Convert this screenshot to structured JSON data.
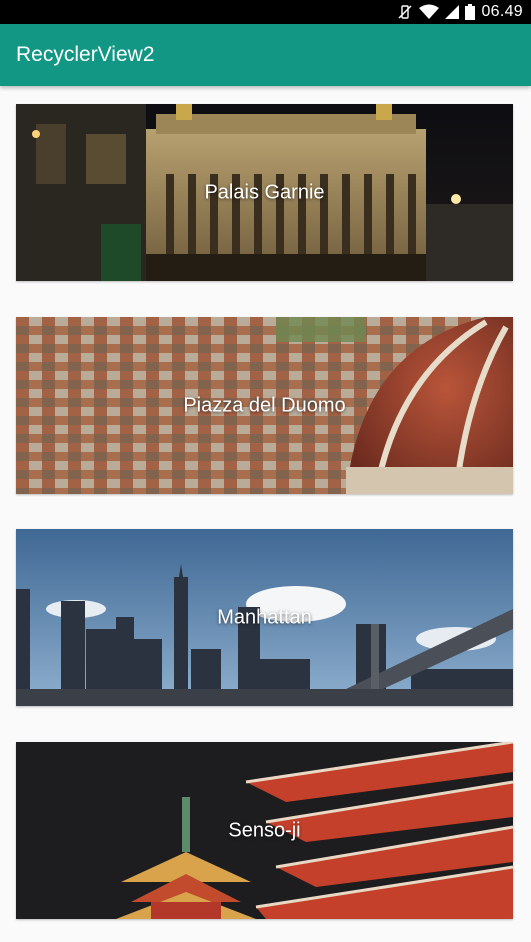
{
  "status_bar": {
    "time": "06.49",
    "icons": [
      "vibrate-off-icon",
      "wifi-icon",
      "signal-icon",
      "battery-icon"
    ]
  },
  "app_bar": {
    "title": "RecyclerView2",
    "color": "#129784"
  },
  "cards": [
    {
      "label": "Palais Garnie",
      "image": "palais-garnier-photo"
    },
    {
      "label": "Piazza del Duomo",
      "image": "piazza-del-duomo-photo"
    },
    {
      "label": "Manhattan",
      "image": "manhattan-skyline-photo"
    },
    {
      "label": "Senso-ji",
      "image": "senso-ji-pagoda-photo"
    }
  ]
}
